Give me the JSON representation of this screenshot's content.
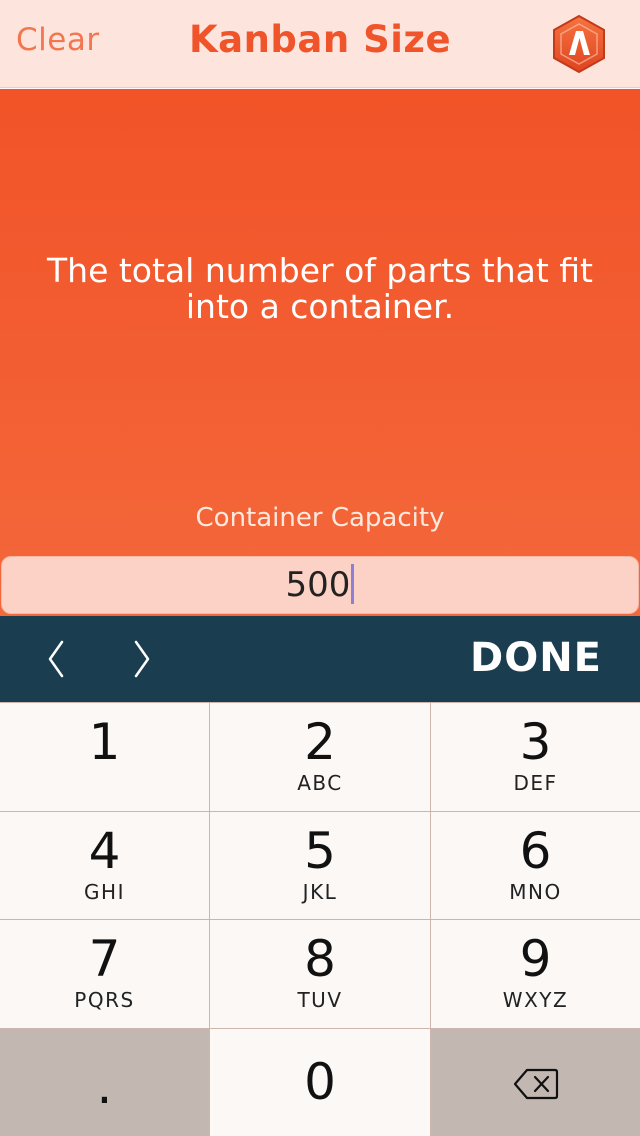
{
  "header": {
    "clear_label": "Clear",
    "title": "Kanban Size",
    "logo_icon": "app-logo-hexagon"
  },
  "panel": {
    "description": "The total number of parts that fit into a container.",
    "field_label": "Container Capacity",
    "field_value": "500"
  },
  "toolbar": {
    "prev_icon": "chevron-left-icon",
    "next_icon": "chevron-right-icon",
    "done_label": "DONE"
  },
  "keypad": {
    "keys": [
      {
        "digit": "1",
        "letters": ""
      },
      {
        "digit": "2",
        "letters": "ABC"
      },
      {
        "digit": "3",
        "letters": "DEF"
      },
      {
        "digit": "4",
        "letters": "GHI"
      },
      {
        "digit": "5",
        "letters": "JKL"
      },
      {
        "digit": "6",
        "letters": "MNO"
      },
      {
        "digit": "7",
        "letters": "PQRS"
      },
      {
        "digit": "8",
        "letters": "TUV"
      },
      {
        "digit": "9",
        "letters": "WXYZ"
      },
      {
        "digit": ".",
        "letters": ""
      },
      {
        "digit": "0",
        "letters": ""
      }
    ],
    "backspace_icon": "backspace-icon"
  },
  "colors": {
    "accent": "#f0542a",
    "toolbar": "#1a3e50",
    "header_bg": "#fde5dd"
  }
}
